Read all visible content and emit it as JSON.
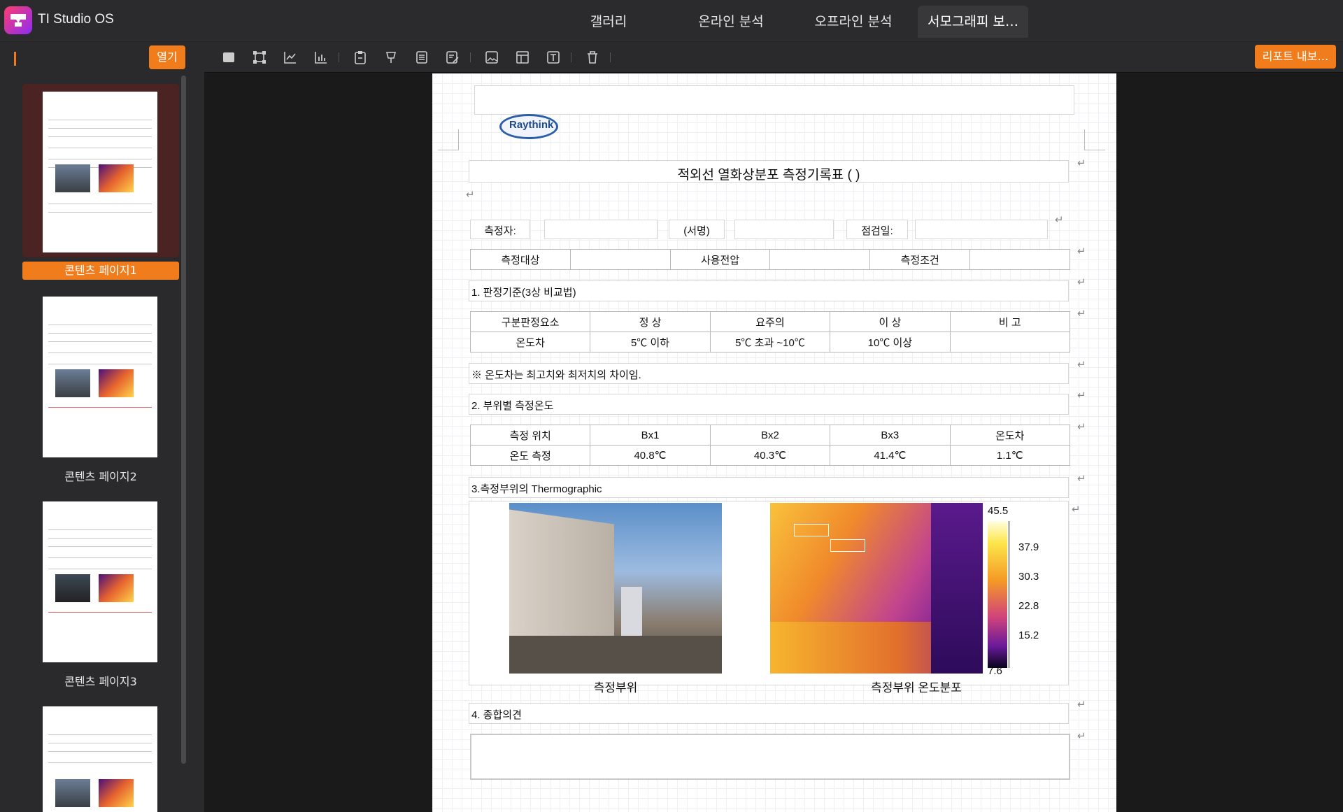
{
  "app": {
    "title": "TI Studio OS"
  },
  "tabs": [
    {
      "label": "갤러리"
    },
    {
      "label": "온라인 분석"
    },
    {
      "label": "오프라인 분석"
    },
    {
      "label": "서모그래피 보…"
    }
  ],
  "sidebar": {
    "open_label": "열기",
    "pages": [
      {
        "label": "콘텐츠 페이지1"
      },
      {
        "label": "콘텐츠 페이지2"
      },
      {
        "label": "콘텐츠 페이지3"
      }
    ]
  },
  "toolbar": {
    "export_label": "리포트 내보…"
  },
  "report": {
    "logo_text": "Raythink",
    "title": "적외선 열화상분포 측정기록표 (          )",
    "measurer_label": "측정자:",
    "sign_label": "(서명)",
    "date_label": "점검일:",
    "target_label": "측정대상",
    "voltage_label": "사용전압",
    "condition_label": "측정조건",
    "section1": "1. 판정기준(3상 비교법)",
    "criteria_headers": [
      "구분판정요소",
      "정    상",
      "요주의",
      "이    상",
      "비    고"
    ],
    "criteria_row": [
      "온도차",
      "5℃ 이하",
      "5℃ 초과 ~10℃",
      "10℃ 이상",
      ""
    ],
    "note": "※  온도차는 최고치와 최저치의 차이임.",
    "section2": "2. 부위별 측정온도",
    "temp_headers": [
      "측정 위치",
      "Bx1",
      "Bx2",
      "Bx3",
      "온도차"
    ],
    "temp_row": [
      "온도 측정",
      "40.8℃",
      "40.3℃",
      "41.4℃",
      "1.1℃"
    ],
    "section3": "3.측정부위의 Thermographic",
    "photo_caption": "측정부위",
    "thermal_caption": "측정부위 온도분포",
    "scale": {
      "max": "45.5",
      "min": "7.6",
      "ticks": [
        "37.9",
        "30.3",
        "22.8",
        "15.2"
      ]
    },
    "section4": "4. 종합의견",
    "return_mark": "↵"
  }
}
